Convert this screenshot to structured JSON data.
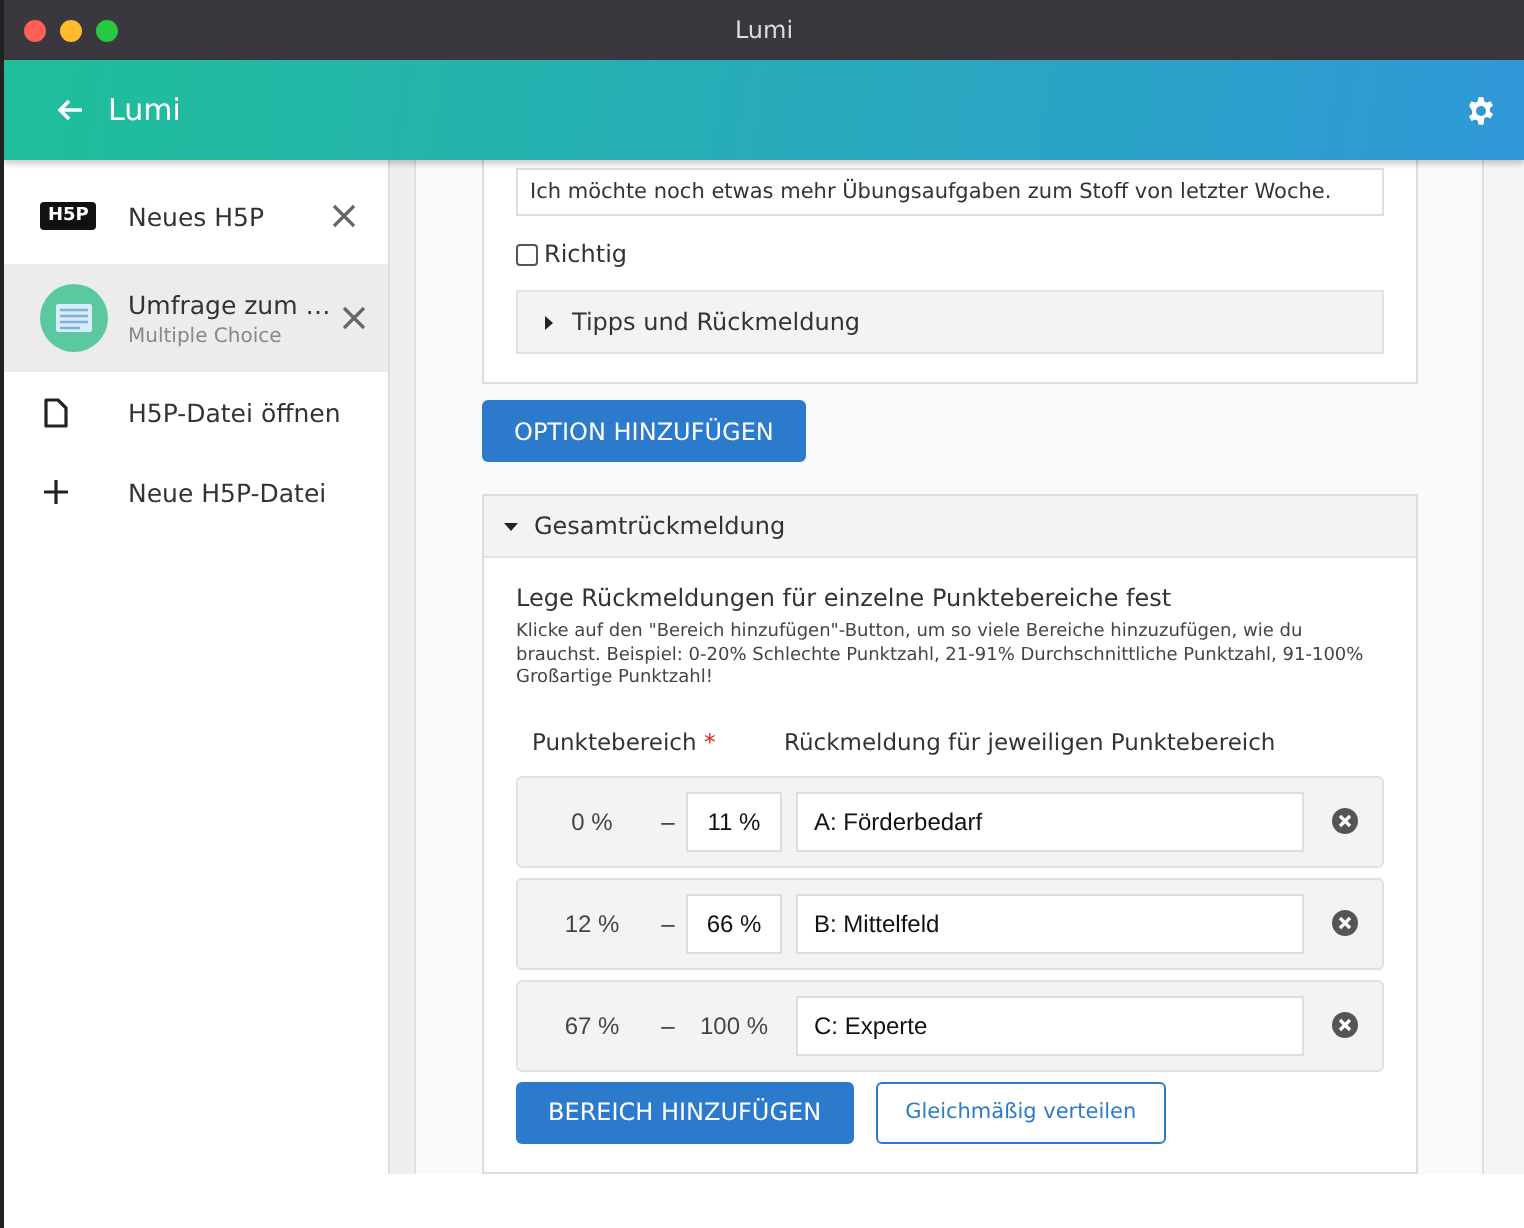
{
  "window": {
    "title": "Lumi"
  },
  "header": {
    "title": "Lumi"
  },
  "sidebar": {
    "items": [
      {
        "kind": "h5p-tab",
        "badge": "H5P",
        "label": "Neues H5P",
        "selected": false
      },
      {
        "kind": "content-tab",
        "label": "Umfrage zum …",
        "subtitle": "Multiple Choice",
        "selected": true
      },
      {
        "kind": "open-file",
        "label": "H5P-Datei öffnen"
      },
      {
        "kind": "new-file",
        "label": "Neue H5P-Datei"
      }
    ]
  },
  "answer": {
    "value": "Ich möchte noch etwas mehr Übungsaufgaben zum Stoff von letzter Woche.",
    "correct": {
      "label": "Richtig",
      "checked": false
    },
    "tips": {
      "label": "Tipps und Rückmeldung",
      "expanded": false
    }
  },
  "add_option_button": "OPTION HINZUFÜGEN",
  "overall_feedback": {
    "label": "Gesamtrückmeldung",
    "expanded": true,
    "heading": "Lege Rückmeldungen für einzelne Punktebereiche fest",
    "description": "Klicke auf den \"Bereich hinzufügen\"-Button, um so viele Bereiche hinzuzufügen, wie du brauchst. Beispiel: 0-20% Schlechte Punktzahl, 21-91% Durchschnittliche Punktzahl, 91-100% Großartige Punktzahl!",
    "columns": [
      {
        "label": "Punktebereich",
        "marker": "*"
      },
      {
        "label": "Rückmeldung für jeweiligen Punktebereich"
      }
    ],
    "ranges": [
      {
        "from": "0 %",
        "separator": "–",
        "to": "11 %",
        "to_editable": true,
        "feedback": "A: Förderbedarf"
      },
      {
        "from": "12 %",
        "separator": "–",
        "to": "66 %",
        "to_editable": true,
        "feedback": "B: Mittelfeld"
      },
      {
        "from": "67 %",
        "separator": "–",
        "to": "100 %",
        "to_editable": false,
        "feedback": "C: Experte"
      }
    ],
    "buttons": [
      {
        "kind": "primary",
        "label": "BEREICH HINZUFÜGEN"
      },
      {
        "kind": "outline",
        "label": "Gleichmäßig verteilen"
      }
    ]
  }
}
